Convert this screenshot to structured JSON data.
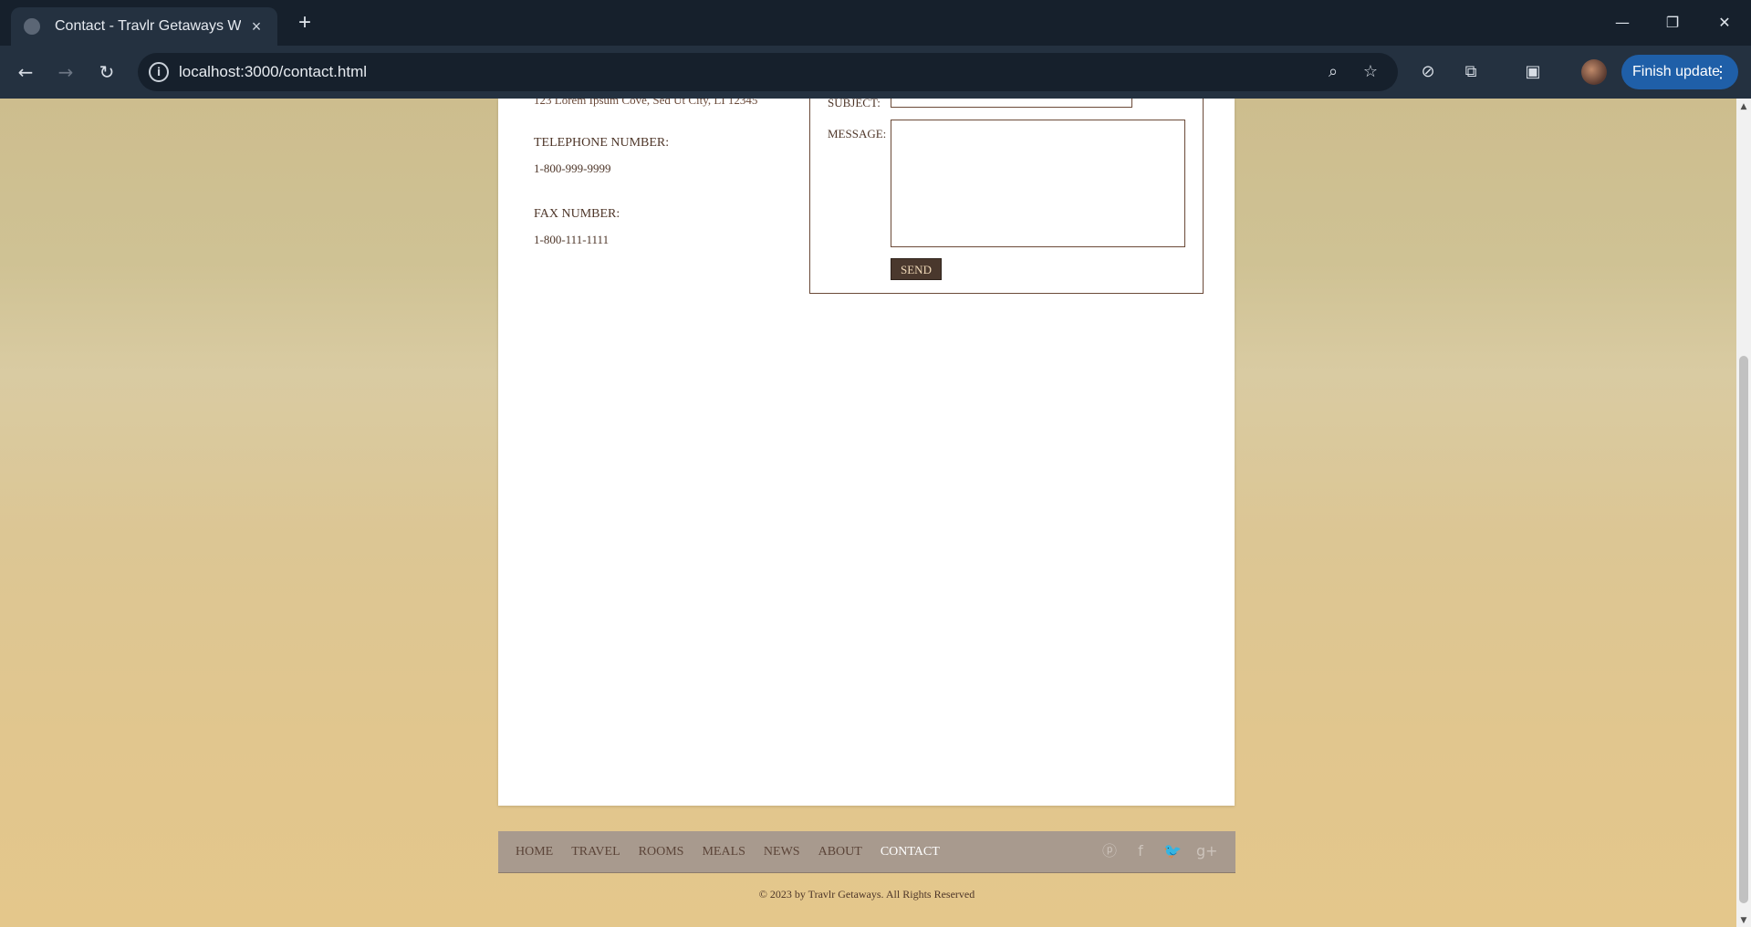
{
  "browser": {
    "tab_title": "Contact - Travlr Getaways Website",
    "new_tab": "+",
    "url": "localhost:3000/contact.html",
    "finish_update": "Finish update",
    "window_controls": {
      "minimize": "—",
      "restore": "❐",
      "close": "✕"
    },
    "nav": {
      "back": "←",
      "forward": "→",
      "reload": "↻"
    }
  },
  "contact": {
    "address_line": "123 Lorem Ipsum Cove, Sed Ut City, LI 12345",
    "telephone_label": "TELEPHONE NUMBER:",
    "telephone_value": "1-800-999-9999",
    "fax_label": "FAX NUMBER:",
    "fax_value": "1-800-111-1111"
  },
  "form": {
    "subject_label": "SUBJECT:",
    "message_label": "MESSAGE:",
    "send_label": "SEND"
  },
  "footer": {
    "nav": [
      {
        "label": "HOME",
        "active": false
      },
      {
        "label": "TRAVEL",
        "active": false
      },
      {
        "label": "ROOMS",
        "active": false
      },
      {
        "label": "MEALS",
        "active": false
      },
      {
        "label": "NEWS",
        "active": false
      },
      {
        "label": "ABOUT",
        "active": false
      },
      {
        "label": "CONTACT",
        "active": true
      }
    ],
    "social_icons": [
      "pinterest-icon",
      "facebook-icon",
      "twitter-icon",
      "google-plus-icon"
    ],
    "copyright": "© 2023 by Travlr Getaways. All Rights Reserved"
  },
  "colors": {
    "accent_brown": "#4a382d",
    "text_brown": "#4e3629",
    "footer_bar": "#a89a8e",
    "browser_primary": "#1f5fa8"
  }
}
